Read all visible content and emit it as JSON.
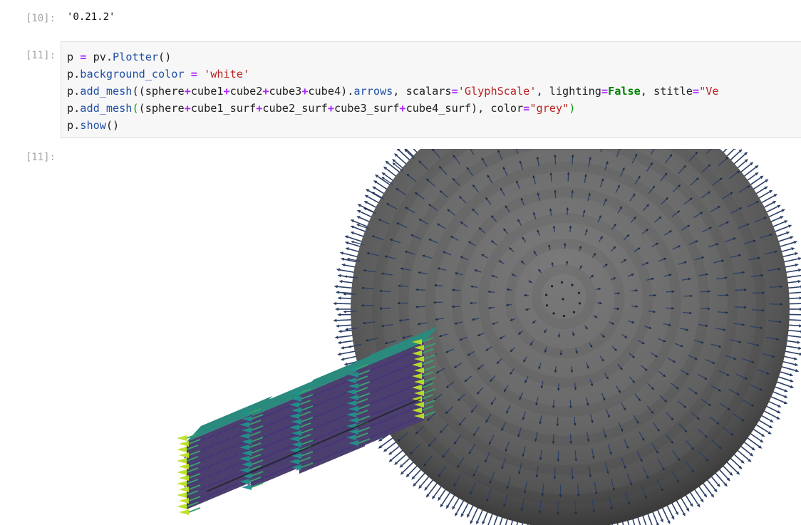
{
  "cells": [
    {
      "prompt": "[10]:",
      "output": "'0.21.2'"
    },
    {
      "prompt": "[11]:",
      "code_lines": [
        [
          [
            "v",
            "p "
          ],
          [
            "o",
            "="
          ],
          [
            "v",
            " pv."
          ],
          [
            "a",
            "Plotter"
          ],
          [
            "v",
            "()"
          ]
        ],
        [
          [
            "v",
            "p."
          ],
          [
            "a",
            "background_color"
          ],
          [
            "v",
            " "
          ],
          [
            "o",
            "="
          ],
          [
            "v",
            " "
          ],
          [
            "s",
            "'white'"
          ]
        ],
        [
          [
            "v",
            "p."
          ],
          [
            "a",
            "add_mesh"
          ],
          [
            "v",
            "((sphere"
          ],
          [
            "o",
            "+"
          ],
          [
            "v",
            "cube1"
          ],
          [
            "o",
            "+"
          ],
          [
            "v",
            "cube2"
          ],
          [
            "o",
            "+"
          ],
          [
            "v",
            "cube3"
          ],
          [
            "o",
            "+"
          ],
          [
            "v",
            "cube4)."
          ],
          [
            "a",
            "arrows"
          ],
          [
            "v",
            ", scalars"
          ],
          [
            "o",
            "="
          ],
          [
            "s",
            "'GlyphScale'"
          ],
          [
            "v",
            ", lighting"
          ],
          [
            "o",
            "="
          ],
          [
            "k",
            "False"
          ],
          [
            "v",
            ", stitle"
          ],
          [
            "o",
            "="
          ],
          [
            "s",
            "\"Ve"
          ]
        ],
        [
          [
            "v",
            "p."
          ],
          [
            "a",
            "add_mesh"
          ],
          [
            "g",
            "("
          ],
          [
            "v",
            "(sphere"
          ],
          [
            "o",
            "+"
          ],
          [
            "v",
            "cube1_surf"
          ],
          [
            "o",
            "+"
          ],
          [
            "v",
            "cube2_surf"
          ],
          [
            "o",
            "+"
          ],
          [
            "v",
            "cube3_surf"
          ],
          [
            "o",
            "+"
          ],
          [
            "v",
            "cube4_surf), color"
          ],
          [
            "o",
            "="
          ],
          [
            "s",
            "\"grey\""
          ],
          [
            "g",
            ")"
          ]
        ],
        [
          [
            "v",
            "p."
          ],
          [
            "a",
            "show"
          ],
          [
            "v",
            "()"
          ]
        ]
      ]
    },
    {
      "prompt": "[11]:",
      "output_render": "pyvista-plot"
    }
  ],
  "colors": {
    "background": "#ffffff",
    "sphere": "#6f6f6f",
    "arrow_sphere": "#2b3f66",
    "arrow_low": "#46317e",
    "arrow_mid": "#21918c",
    "arrow_high": "#bddf26"
  }
}
